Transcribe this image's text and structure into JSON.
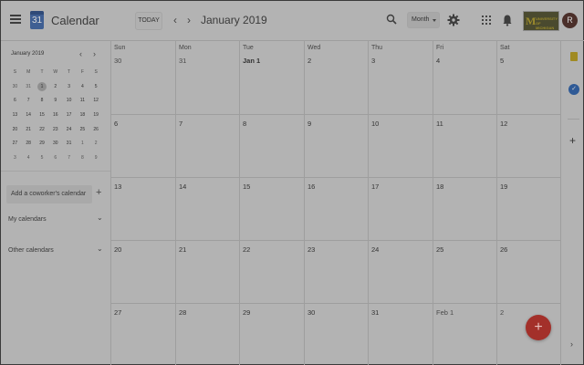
{
  "header": {
    "app_icon_day": "31",
    "app_title": "Calendar",
    "today_label": "TODAY",
    "prev_label": "‹",
    "next_label": "›",
    "month_title": "January 2019",
    "view_label": "Month",
    "org_logo_mark": "M",
    "org_logo_text_1": "UNIVERSITY OF",
    "org_logo_text_2": "MICHIGAN",
    "avatar_initial": "R"
  },
  "mini_calendar": {
    "title": "January 2019",
    "prev_label": "‹",
    "next_label": "›",
    "weekdays": [
      "S",
      "M",
      "T",
      "W",
      "T",
      "F",
      "S"
    ],
    "weeks": [
      [
        "30",
        "31",
        "1",
        "2",
        "3",
        "4",
        "5"
      ],
      [
        "6",
        "7",
        "8",
        "9",
        "10",
        "11",
        "12"
      ],
      [
        "13",
        "14",
        "15",
        "16",
        "17",
        "18",
        "19"
      ],
      [
        "20",
        "21",
        "22",
        "23",
        "24",
        "25",
        "26"
      ],
      [
        "27",
        "28",
        "29",
        "30",
        "31",
        "1",
        "2"
      ],
      [
        "3",
        "4",
        "5",
        "6",
        "7",
        "8",
        "9"
      ]
    ]
  },
  "sidebar": {
    "coworker_placeholder": "Add a coworker's calendar",
    "add_label": "+",
    "my_calendars": "My calendars",
    "other_calendars": "Other calendars",
    "caret": "⌄"
  },
  "grid": {
    "weekdays": [
      "Sun",
      "Mon",
      "Tue",
      "Wed",
      "Thu",
      "Fri",
      "Sat"
    ],
    "weeks": [
      [
        "30",
        "31",
        "Jan 1",
        "2",
        "3",
        "4",
        "5"
      ],
      [
        "6",
        "7",
        "8",
        "9",
        "10",
        "11",
        "12"
      ],
      [
        "13",
        "14",
        "15",
        "16",
        "17",
        "18",
        "19"
      ],
      [
        "20",
        "21",
        "22",
        "23",
        "24",
        "25",
        "26"
      ],
      [
        "27",
        "28",
        "29",
        "30",
        "31",
        "Feb 1",
        "2"
      ]
    ]
  },
  "rail": {
    "tasks_mark": "✓",
    "add_label": "+",
    "expand_label": "›"
  },
  "fab": {
    "label": "+"
  },
  "colors": {
    "overlay_bg": "#b3b3b3",
    "fab": "#a3302a",
    "avatar": "#4b2f2a",
    "logo": "#3f5f93"
  }
}
